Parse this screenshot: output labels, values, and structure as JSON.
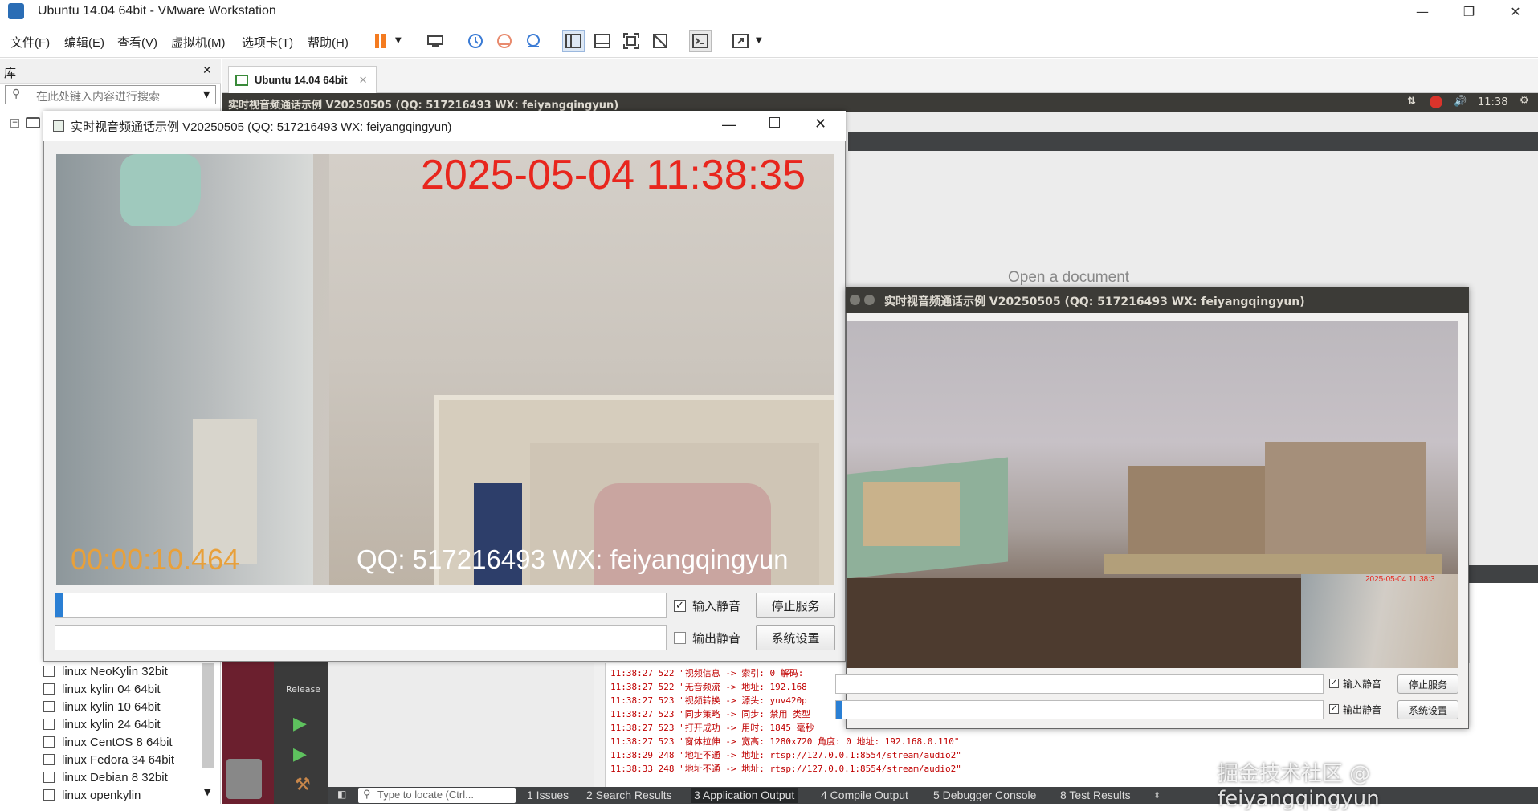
{
  "window": {
    "title": "Ubuntu 14.04 64bit - VMware Workstation",
    "minimize": "—",
    "maximize": "❐",
    "close": "✕"
  },
  "menu": [
    "文件(F)",
    "编辑(E)",
    "查看(V)",
    "虚拟机(M)",
    "选项卡(T)",
    "帮助(H)"
  ],
  "library": {
    "title": "库",
    "close": "✕",
    "search_placeholder": "在此处键入内容进行搜索",
    "items": [
      "linux NeoKylin 32bit",
      "linux kylin 04 64bit",
      "linux kylin 10 64bit",
      "linux kylin 24 64bit",
      "linux CentOS 8 64bit",
      "linux Fedora 34 64bit",
      "linux Debian 8 32bit",
      "linux openkylin"
    ]
  },
  "vm_tab": {
    "label": "Ubuntu 14.04 64bit",
    "close": "✕"
  },
  "ubuntu_topbar": {
    "title": "实时视音频通话示例 V20250505 (QQ: 517216493 WX: feiyangqingyun)",
    "time": "11:38"
  },
  "qt": {
    "placeholder_doc": "Open a document",
    "release_label": "Release",
    "locate_placeholder": "Type to locate (Ctrl...",
    "bottom_tabs": [
      "1  Issues",
      "2  Search Results",
      "3  Application Output",
      "4  Compile Output",
      "5  Debugger Console",
      "8  Test Results"
    ],
    "log": [
      "11:38:27 522 \"视频信息 -> 索引: 0 解码:",
      "11:38:27 522 \"无音频流 -> 地址: 192.168",
      "11:38:27 523 \"视频转换 -> 源头: yuv420p",
      "11:38:27 523 \"同步策略 -> 同步: 禁用 类型",
      "11:38:27 523 \"打开成功 -> 用时: 1845 毫秒",
      "11:38:27 523 \"窗体拉伸 -> 宽高: 1280x720 角度: 0 地址: 192.168.0.110\"",
      "11:38:29 248 \"地址不通 -> 地址: rtsp://127.0.0.1:8554/stream/audio2\"",
      "11:38:33 248 \"地址不通 -> 地址: rtsp://127.0.0.1:8554/stream/audio2\""
    ]
  },
  "win1": {
    "title": "实时视音频通话示例 V20250505 (QQ: 517216493 WX: feiyangqingyun)",
    "overlay_datetime": "2025-05-04 11:38:35",
    "overlay_elapsed": "00:00:10.464",
    "overlay_contact": "QQ: 517216493  WX: feiyangqingyun",
    "input_mute": "输入静音",
    "output_mute": "输出静音",
    "stop_service": "停止服务",
    "settings": "系统设置",
    "input_mute_checked": true,
    "output_mute_checked": false
  },
  "win2": {
    "title": "实时视音频通话示例 V20250505 (QQ: 517216493 WX: feiyangqingyun)",
    "overlay_datetime": "2025-05-04 11:38:3",
    "input_mute": "输入静音",
    "output_mute": "输出静音",
    "stop_service": "停止服务",
    "settings": "系统设置"
  },
  "watermark": "掘金技术社区 @ feiyangqingyun",
  "colors": {
    "overlay_red": "#e8261d",
    "overlay_orange": "#e8a03a"
  }
}
